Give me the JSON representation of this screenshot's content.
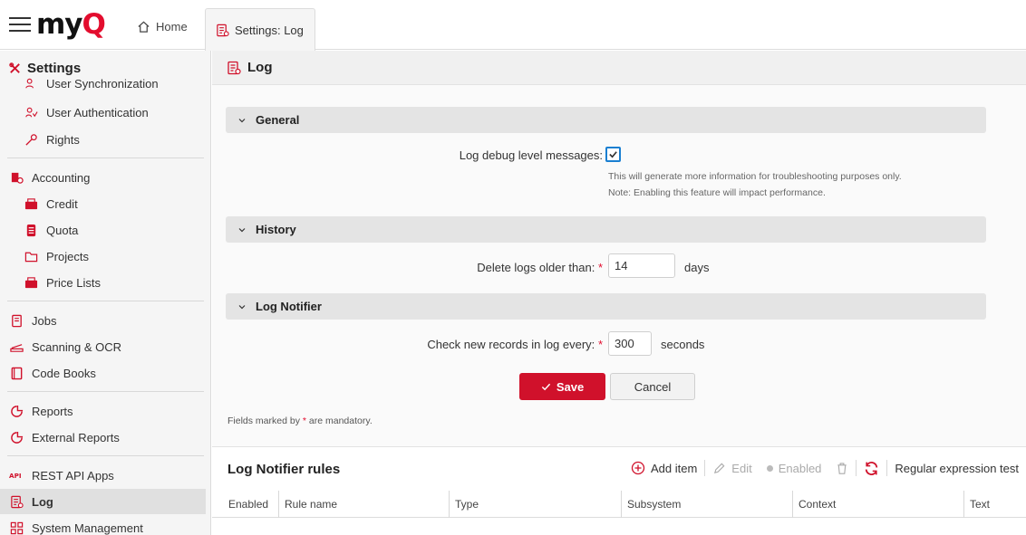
{
  "app": {
    "logo_prefix": "my",
    "logo_accent": "Q",
    "brand_color": "#e30d2e",
    "tabs": [
      {
        "label": "Home",
        "icon": "home-icon"
      },
      {
        "label": "Settings: Log",
        "icon": "log-icon"
      }
    ]
  },
  "sidebar": {
    "title": "Settings",
    "title_icon": "tools-icon",
    "items": [
      {
        "label": "User Synchronization",
        "icon": "sync-users-icon"
      },
      {
        "label": "User Authentication",
        "icon": "user-auth-icon"
      },
      {
        "label": "Rights",
        "icon": "key-icon"
      },
      {
        "label": "Accounting",
        "icon": "accounting-icon"
      },
      {
        "label": "Credit",
        "icon": "credit-icon"
      },
      {
        "label": "Quota",
        "icon": "quota-icon"
      },
      {
        "label": "Projects",
        "icon": "folder-icon"
      },
      {
        "label": "Price Lists",
        "icon": "price-list-icon"
      },
      {
        "label": "Jobs",
        "icon": "jobs-icon"
      },
      {
        "label": "Scanning & OCR",
        "icon": "scanner-icon"
      },
      {
        "label": "Code Books",
        "icon": "book-icon"
      },
      {
        "label": "Reports",
        "icon": "reports-icon"
      },
      {
        "label": "External Reports",
        "icon": "external-reports-icon"
      },
      {
        "label": "REST API Apps",
        "icon": "api-icon"
      },
      {
        "label": "Log",
        "icon": "log-icon",
        "active": true
      },
      {
        "label": "System Management",
        "icon": "system-icon"
      }
    ]
  },
  "main": {
    "title": "Log",
    "sections": {
      "general": "General",
      "history": "History",
      "notifier": "Log Notifier"
    },
    "debug": {
      "label": "Log debug level messages:",
      "checked": true,
      "hint1": "This will generate more information for troubleshooting purposes only.",
      "hint2": "Note: Enabling this feature will impact performance."
    },
    "delete_logs": {
      "label": "Delete logs older than:",
      "required": "*",
      "value": "14",
      "unit": "days"
    },
    "check_records": {
      "label": "Check new records in log every:",
      "required": "*",
      "value": "300",
      "unit": "seconds"
    },
    "save_label": "Save",
    "cancel_label": "Cancel",
    "mandatory_prefix": "Fields marked by",
    "mandatory_star": "*",
    "mandatory_suffix": "are mandatory."
  },
  "rules": {
    "title": "Log Notifier rules",
    "toolbar": {
      "add": "Add item",
      "edit": "Edit",
      "enabled": "Enabled",
      "regex": "Regular expression test"
    },
    "columns": [
      "Enabled",
      "Rule name",
      "Type",
      "Subsystem",
      "Context",
      "Text"
    ]
  }
}
